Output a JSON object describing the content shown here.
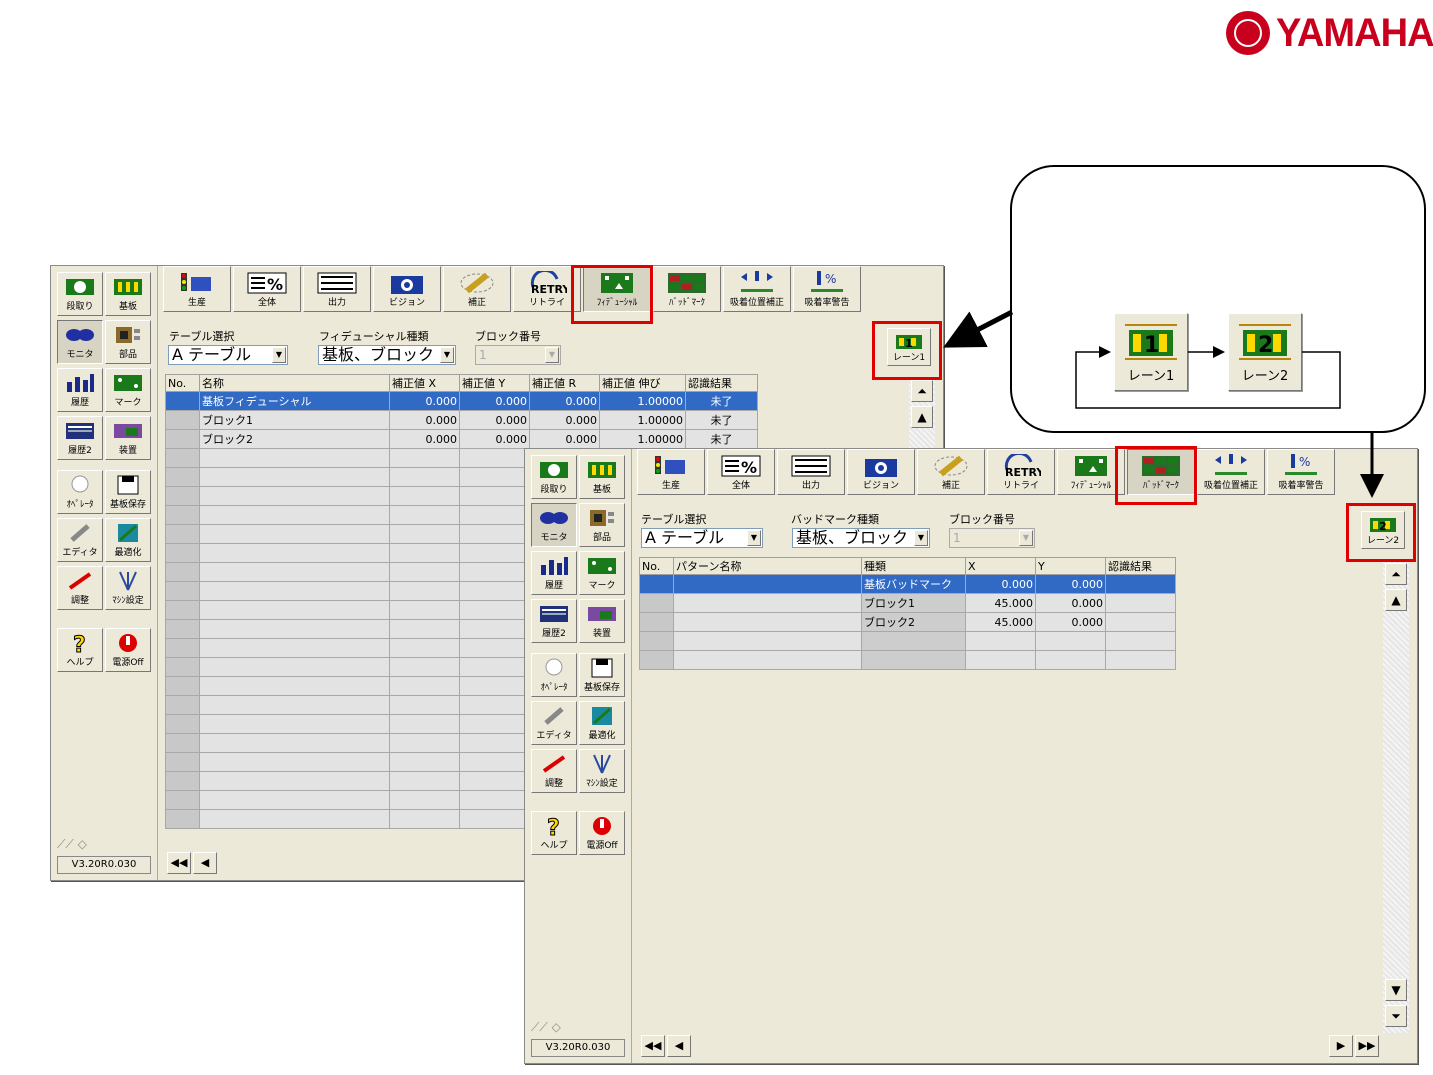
{
  "brand": {
    "name": "YAMAHA"
  },
  "sidebar": {
    "items": [
      {
        "label": "段取り",
        "icon": "setup-icon"
      },
      {
        "label": "基板",
        "icon": "board-icon"
      },
      {
        "label": "モニタ",
        "icon": "monitor-icon"
      },
      {
        "label": "部品",
        "icon": "parts-icon"
      },
      {
        "label": "履歴",
        "icon": "history-icon"
      },
      {
        "label": "マーク",
        "icon": "mark-icon"
      },
      {
        "label": "履歴2",
        "icon": "history2-icon"
      },
      {
        "label": "装置",
        "icon": "device-icon"
      },
      {
        "label": "ｵﾍﾟﾚｰﾀ",
        "icon": "operator-icon"
      },
      {
        "label": "基板保存",
        "icon": "save-icon"
      },
      {
        "label": "エディタ",
        "icon": "editor-icon"
      },
      {
        "label": "最適化",
        "icon": "optimize-icon"
      },
      {
        "label": "調整",
        "icon": "adjust-icon"
      },
      {
        "label": "ﾏｼﾝ設定",
        "icon": "machine-settings-icon"
      },
      {
        "label": "ヘルプ",
        "icon": "help-icon"
      },
      {
        "label": "電源Off",
        "icon": "power-icon"
      }
    ],
    "version": "V3.20R0.030"
  },
  "toolbar": {
    "tabs": [
      {
        "label": "生産",
        "icon": "production-icon"
      },
      {
        "label": "全体",
        "icon": "overall-percent-icon"
      },
      {
        "label": "出力",
        "icon": "output-icon"
      },
      {
        "label": "ビジョン",
        "icon": "camera-icon"
      },
      {
        "label": "補正",
        "icon": "correction-icon"
      },
      {
        "label": "リトライ",
        "icon": "retry-icon"
      },
      {
        "label": "ﾌｨﾃﾞｭｰｼｬﾙ",
        "icon": "fiducial-icon"
      },
      {
        "label": "ﾊﾞｯﾄﾞﾏｰｸ",
        "icon": "badmark-icon"
      },
      {
        "label": "吸着位置補正",
        "icon": "pickup-position-icon"
      },
      {
        "label": "吸着率警告",
        "icon": "pickup-rate-icon"
      }
    ]
  },
  "window1": {
    "table_select_label": "テーブル選択",
    "table_select_value": "A テーブル",
    "type_label": "フィデューシャル種類",
    "type_value": "基板、ブロック",
    "block_label": "ブロック番号",
    "block_value": "1",
    "lane_button": "レーン1",
    "columns": [
      "No.",
      "名称",
      "補正値 X",
      "補正値 Y",
      "補正値 R",
      "補正値 伸び",
      "認識結果"
    ],
    "rows": [
      [
        "",
        "基板フィデューシャル",
        "0.000",
        "0.000",
        "0.000",
        "1.00000",
        "未了"
      ],
      [
        "",
        "ブロック1",
        "0.000",
        "0.000",
        "0.000",
        "1.00000",
        "未了"
      ],
      [
        "",
        "ブロック2",
        "0.000",
        "0.000",
        "0.000",
        "1.00000",
        "未了"
      ]
    ]
  },
  "window2": {
    "table_select_label": "テーブル選択",
    "table_select_value": "A テーブル",
    "type_label": "バッドマーク種類",
    "type_value": "基板、ブロック",
    "block_label": "ブロック番号",
    "block_value": "1",
    "lane_button": "レーン2",
    "columns": [
      "No.",
      "パターン名称",
      "種類",
      "X",
      "Y",
      "認識結果"
    ],
    "rows": [
      [
        "",
        "",
        "基板バッドマーク",
        "0.000",
        "0.000",
        ""
      ],
      [
        "",
        "",
        "ブロック1",
        "45.000",
        "0.000",
        ""
      ],
      [
        "",
        "",
        "ブロック2",
        "45.000",
        "0.000",
        ""
      ]
    ]
  },
  "callout": {
    "lane1": "レーン1",
    "lane2": "レーン2"
  },
  "colors": {
    "highlight": "#e00000",
    "selection": "#316ac5",
    "brand": "#c8001e"
  }
}
